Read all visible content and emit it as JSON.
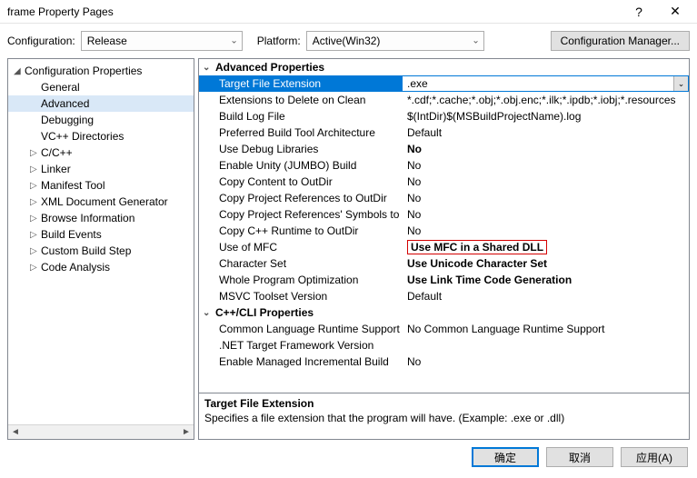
{
  "window": {
    "title": "frame Property Pages",
    "help_glyph": "?",
    "close_glyph": "✕"
  },
  "config_bar": {
    "config_label": "Configuration:",
    "config_value": "Release",
    "platform_label": "Platform:",
    "platform_value": "Active(Win32)",
    "manager_btn": "Configuration Manager..."
  },
  "tree": {
    "root": "Configuration Properties",
    "items": [
      {
        "label": "General",
        "expandable": false
      },
      {
        "label": "Advanced",
        "expandable": false,
        "selected": true
      },
      {
        "label": "Debugging",
        "expandable": false
      },
      {
        "label": "VC++ Directories",
        "expandable": false
      },
      {
        "label": "C/C++",
        "expandable": true
      },
      {
        "label": "Linker",
        "expandable": true
      },
      {
        "label": "Manifest Tool",
        "expandable": true
      },
      {
        "label": "XML Document Generator",
        "expandable": true
      },
      {
        "label": "Browse Information",
        "expandable": true
      },
      {
        "label": "Build Events",
        "expandable": true
      },
      {
        "label": "Custom Build Step",
        "expandable": true
      },
      {
        "label": "Code Analysis",
        "expandable": true
      }
    ]
  },
  "grid": {
    "groups": [
      {
        "title": "Advanced Properties",
        "rows": [
          {
            "name": "Target File Extension",
            "value": ".exe",
            "selected": true
          },
          {
            "name": "Extensions to Delete on Clean",
            "value": "*.cdf;*.cache;*.obj;*.obj.enc;*.ilk;*.ipdb;*.iobj;*.resources"
          },
          {
            "name": "Build Log File",
            "value": "$(IntDir)$(MSBuildProjectName).log"
          },
          {
            "name": "Preferred Build Tool Architecture",
            "value": "Default"
          },
          {
            "name": "Use Debug Libraries",
            "value": "No",
            "bold": true
          },
          {
            "name": "Enable Unity (JUMBO) Build",
            "value": "No"
          },
          {
            "name": "Copy Content to OutDir",
            "value": "No"
          },
          {
            "name": "Copy Project References to OutDir",
            "value": "No"
          },
          {
            "name": "Copy Project References' Symbols to OutDir",
            "value": "No"
          },
          {
            "name": "Copy C++ Runtime to OutDir",
            "value": "No"
          },
          {
            "name": "Use of MFC",
            "value": "Use MFC in a Shared DLL",
            "bold": true,
            "highlight": true
          },
          {
            "name": "Character Set",
            "value": "Use Unicode Character Set",
            "bold": true
          },
          {
            "name": "Whole Program Optimization",
            "value": "Use Link Time Code Generation",
            "bold": true
          },
          {
            "name": "MSVC Toolset Version",
            "value": "Default"
          }
        ]
      },
      {
        "title": "C++/CLI Properties",
        "rows": [
          {
            "name": "Common Language Runtime Support",
            "value": "No Common Language Runtime Support"
          },
          {
            "name": ".NET Target Framework Version",
            "value": ""
          },
          {
            "name": "Enable Managed Incremental Build",
            "value": "No"
          }
        ]
      }
    ]
  },
  "description": {
    "title": "Target File Extension",
    "text": "Specifies a file extension that the program will have. (Example: .exe or .dll)"
  },
  "buttons": {
    "ok": "确定",
    "cancel": "取消",
    "apply": "应用(A)"
  }
}
